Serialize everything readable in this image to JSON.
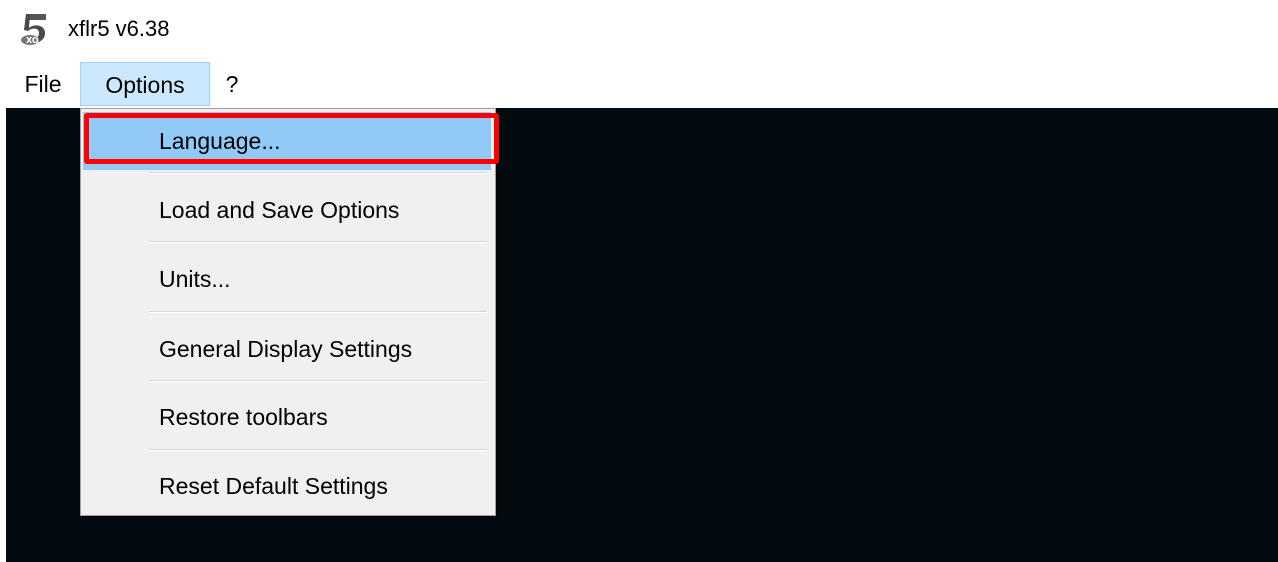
{
  "window": {
    "title": "xflr5 v6.38",
    "icon": "xflr5-app-icon"
  },
  "menubar": {
    "items": [
      {
        "label": "File"
      },
      {
        "label": "Options"
      },
      {
        "label": "?"
      }
    ],
    "active": "Options"
  },
  "options_menu": {
    "items": [
      {
        "label": "Language..."
      },
      {
        "label": "Load and Save Options"
      },
      {
        "label": "Units..."
      },
      {
        "label": "General Display Settings"
      },
      {
        "label": "Restore toolbars"
      },
      {
        "label": "Reset Default Settings"
      }
    ],
    "highlighted": "Language..."
  },
  "colors": {
    "workspace": "#030a10",
    "menu_active": "#cce8ff",
    "item_highlight": "#91c9f7",
    "annotation": "#ff0000"
  }
}
